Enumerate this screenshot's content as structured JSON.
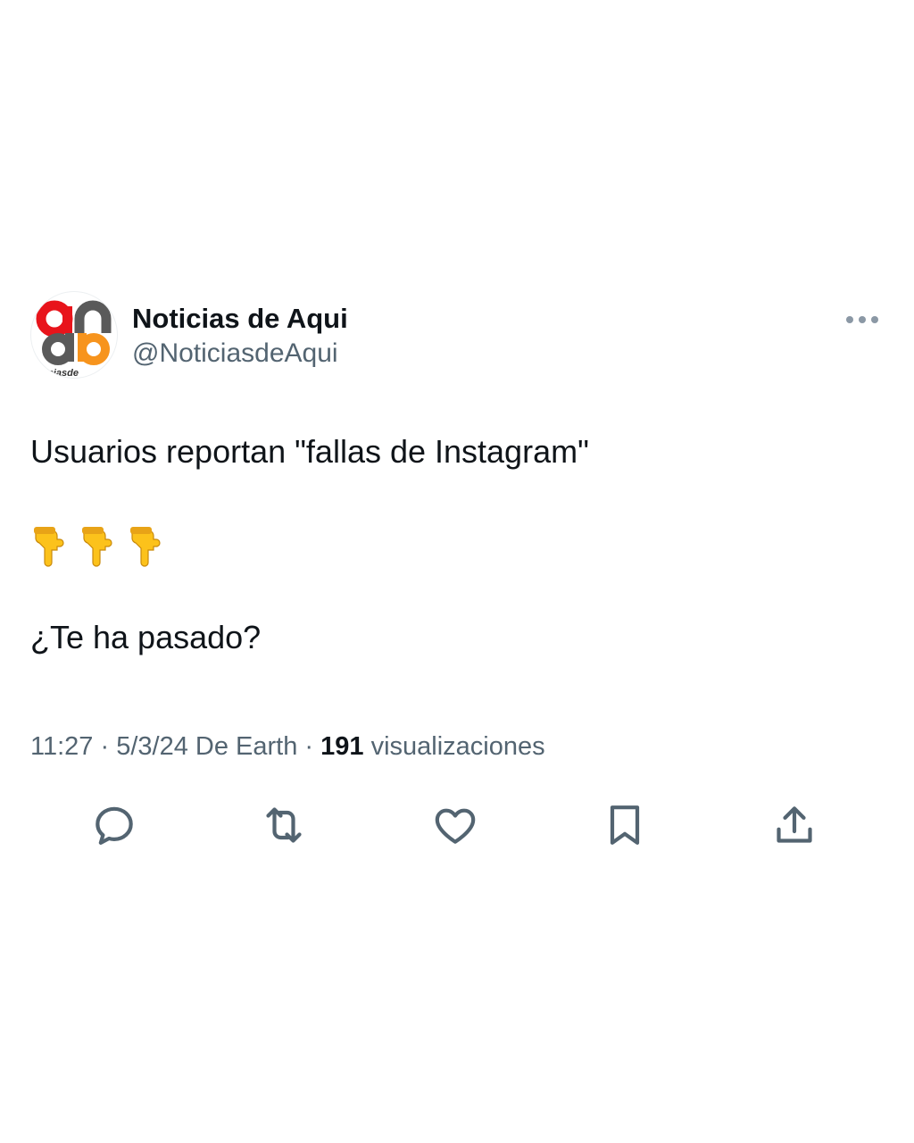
{
  "tweet": {
    "author": {
      "display_name": "Noticias de Aqui",
      "handle": "@NoticiasdeAqui",
      "avatar_logo_text": "ticiasde"
    },
    "text": {
      "line1": "Usuarios reportan \"fallas de Instagram\"",
      "emoji_count": 3,
      "emoji_name": "backhand-index-pointing-down",
      "line3": "¿Te ha pasado?"
    },
    "meta": {
      "time": "11:27",
      "separator1": " · ",
      "date": "5/3/24",
      "source": "De Earth",
      "separator2": " · ",
      "views_count": "191",
      "views_label": "visualizaciones"
    },
    "actions": [
      {
        "name": "reply",
        "icon": "reply-icon"
      },
      {
        "name": "retweet",
        "icon": "retweet-icon"
      },
      {
        "name": "like",
        "icon": "heart-icon"
      },
      {
        "name": "bookmark",
        "icon": "bookmark-icon"
      },
      {
        "name": "share",
        "icon": "share-icon"
      }
    ]
  },
  "colors": {
    "text_primary": "#0f1419",
    "text_secondary": "#536471",
    "icon": "#536471",
    "logo_red": "#e8141b",
    "logo_orange": "#f7941d",
    "logo_gray": "#5a5a5a"
  }
}
